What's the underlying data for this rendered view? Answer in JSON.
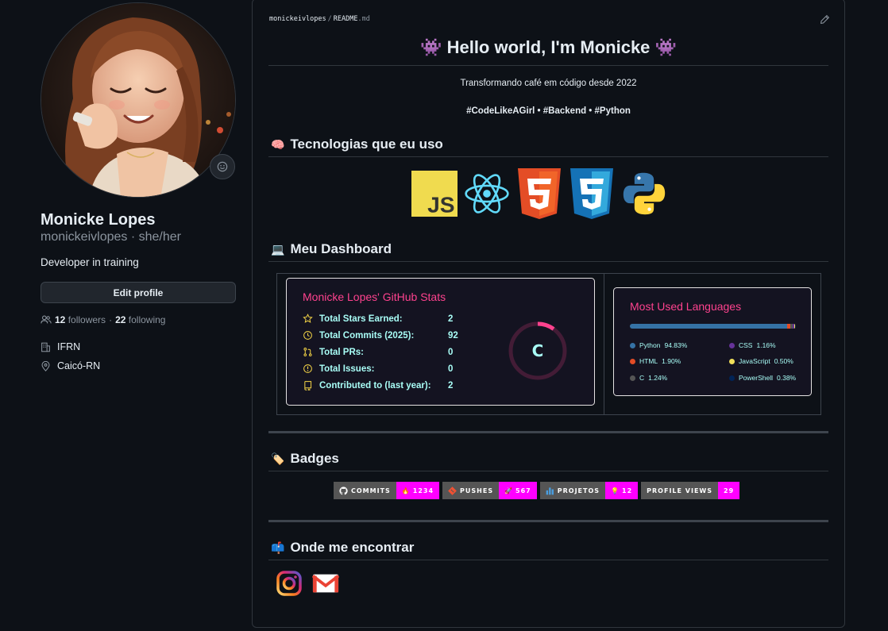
{
  "profile": {
    "name": "Monicke Lopes",
    "login_pronouns": "monickeivlopes · she/her",
    "bio": "Developer in training",
    "edit_button": "Edit profile",
    "followers_count": "12",
    "followers_label": "followers",
    "separator": "·",
    "following_count": "22",
    "following_label": "following",
    "organization": "IFRN",
    "location": "Caicó-RN"
  },
  "readme": {
    "breadcrumb_user": "monickeivlopes",
    "breadcrumb_sep": "/",
    "breadcrumb_file": "README",
    "breadcrumb_ext": ".md",
    "heading": "👾 Hello world, I'm Monicke 👾",
    "tagline": "Transformando café em código desde 2022",
    "hashtags": "#CodeLikeAGirl • #Backend • #Python",
    "section_tech": "Tecnologias que eu uso",
    "section_tech_emoji": "🧠",
    "section_dashboard": "Meu Dashboard",
    "section_dashboard_emoji": "💻",
    "section_badges": "Badges",
    "section_badges_emoji": "🏷️",
    "section_contact": "Onde me encontrar",
    "section_contact_emoji": "📫",
    "tech_icons": [
      "javascript-icon",
      "react-icon",
      "html5-icon",
      "css3-icon",
      "python-icon"
    ],
    "js_text": "JS"
  },
  "stats": {
    "title": "Monicke Lopes' GitHub Stats",
    "rows": [
      {
        "label": "Total Stars Earned:",
        "value": "2",
        "icon": "star-icon"
      },
      {
        "label": "Total Commits (2025):",
        "value": "92",
        "icon": "history-icon"
      },
      {
        "label": "Total PRs:",
        "value": "0",
        "icon": "pull-request-icon"
      },
      {
        "label": "Total Issues:",
        "value": "0",
        "icon": "issue-icon"
      },
      {
        "label": "Contributed to (last year):",
        "value": "2",
        "icon": "repo-icon"
      }
    ],
    "grade": "C",
    "grade_progress": 0.1,
    "colors": {
      "title": "#fe428e",
      "text": "#a9fef7",
      "icon": "#f8d847",
      "bg": "#141321"
    }
  },
  "languages": {
    "title": "Most Used Languages",
    "items": [
      {
        "name": "Python",
        "percent": "94.83%",
        "value": 94.83,
        "color": "#3572A5"
      },
      {
        "name": "CSS",
        "percent": "1.16%",
        "value": 1.16,
        "color": "#663399"
      },
      {
        "name": "HTML",
        "percent": "1.90%",
        "value": 1.9,
        "color": "#e34c26"
      },
      {
        "name": "JavaScript",
        "percent": "0.50%",
        "value": 0.5,
        "color": "#f1e05a"
      },
      {
        "name": "C",
        "percent": "1.24%",
        "value": 1.24,
        "color": "#555555"
      },
      {
        "name": "PowerShell",
        "percent": "0.38%",
        "value": 0.38,
        "color": "#012456"
      }
    ]
  },
  "badges": [
    {
      "label": "COMMITS",
      "value": "1234",
      "icon": "github-icon",
      "value_icon": "🔥"
    },
    {
      "label": "PUSHES",
      "value": "567",
      "icon": "git-icon",
      "value_icon": "🚀"
    },
    {
      "label": "PROJETOS",
      "value": "12",
      "icon": "chart-icon",
      "value_icon": "💡"
    },
    {
      "label": "PROFILE VIEWS",
      "value": "29",
      "icon": "",
      "value_icon": ""
    }
  ],
  "contact": [
    "instagram-icon",
    "gmail-icon"
  ]
}
